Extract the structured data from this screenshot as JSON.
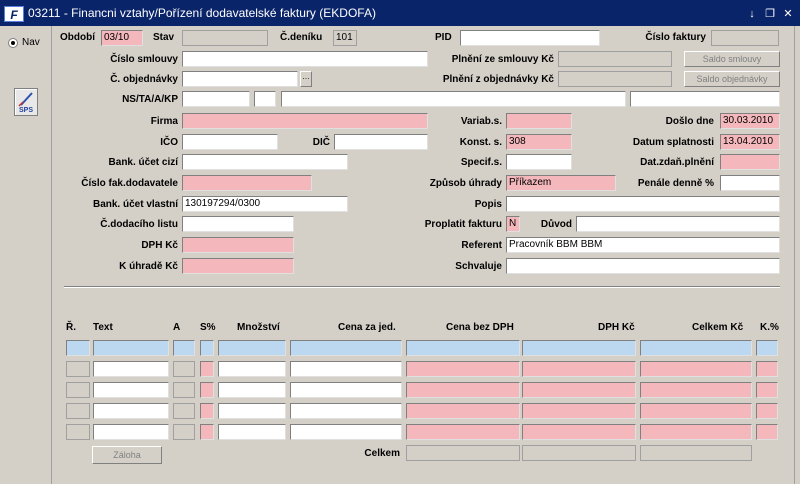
{
  "window": {
    "app_icon": "F",
    "title": "03211 - Financni vztahy/Pořízení dodavatelské faktury (EKDOFA)",
    "controls": [
      "minimize-icon",
      "restore-icon",
      "close-icon"
    ]
  },
  "nav": {
    "radio_label": "Nav",
    "sps_label": "SPS"
  },
  "form": {
    "obdobi": {
      "label": "Období",
      "value": "03/10"
    },
    "stav": {
      "label": "Stav",
      "value": ""
    },
    "c_deniku": {
      "label": "Č.deníku",
      "value": "101"
    },
    "pid": {
      "label": "PID",
      "value": ""
    },
    "cislo_faktury": {
      "label": "Číslo faktury",
      "value": ""
    },
    "cislo_smlouvy": {
      "label": "Číslo smlouvy",
      "value": ""
    },
    "plneni_smlouvy": {
      "label": "Plnění ze smlouvy Kč",
      "value": ""
    },
    "saldo_smlouvy": "Saldo smlouvy",
    "c_objednavky": {
      "label": "Č. objednávky",
      "value": ""
    },
    "plneni_objednavky": {
      "label": "Plnění z objednávky Kč",
      "value": ""
    },
    "saldo_objednavky": "Saldo objednávky",
    "ns_ta": {
      "label": "NS/TA/A/KP"
    },
    "firma": {
      "label": "Firma",
      "value": ""
    },
    "varias": {
      "label": "Variab.s.",
      "value": ""
    },
    "doslo_dne": {
      "label": "Došlo dne",
      "value": "30.03.2010"
    },
    "ico": {
      "label": "IČO",
      "value": ""
    },
    "dic": {
      "label": "DIČ",
      "value": ""
    },
    "konst_s": {
      "label": "Konst. s.",
      "value": "308"
    },
    "datum_splatnosti": {
      "label": "Datum splatnosti",
      "value": "13.04.2010"
    },
    "bank_ucet_cizi": {
      "label": "Bank. účet cizí",
      "value": ""
    },
    "specif_s": {
      "label": "Specif.s.",
      "value": ""
    },
    "dat_zdan_plneni": {
      "label": "Dat.zdaň.plnění",
      "value": ""
    },
    "cislo_fak_dod": {
      "label": "Číslo fak.dodavatele",
      "value": ""
    },
    "zpusob_uhrady": {
      "label": "Způsob úhrady",
      "value": "Příkazem"
    },
    "penale": {
      "label": "Penále denně %",
      "value": ""
    },
    "bank_ucet_vlastni": {
      "label": "Bank. účet vlastní",
      "value": "130197294/0300"
    },
    "popis": {
      "label": "Popis",
      "value": ""
    },
    "c_dodaciho_listu": {
      "label": "Č.dodacího listu",
      "value": ""
    },
    "proplatit_fakturu": {
      "label": "Proplatit fakturu",
      "value": "N"
    },
    "duvod": {
      "label": "Důvod",
      "value": ""
    },
    "dph_kc": {
      "label": "DPH Kč",
      "value": ""
    },
    "referent": {
      "label": "Referent",
      "value": "Pracovník BBM BBM"
    },
    "k_uhrade": {
      "label": "K úhradě Kč",
      "value": ""
    },
    "schvaluje": {
      "label": "Schvaluje",
      "value": ""
    }
  },
  "table": {
    "headers": {
      "r": "Ř.",
      "text": "Text",
      "a": "A",
      "s": "S%",
      "mnozstvi": "Množství",
      "cena_jed": "Cena za jed.",
      "cena_bez_dph": "Cena bez DPH",
      "dph": "DPH Kč",
      "celkem": "Celkem Kč",
      "k": "K.%"
    },
    "row_count": 5,
    "zaloha_button": "Záloha",
    "celkem_label": "Celkem"
  }
}
